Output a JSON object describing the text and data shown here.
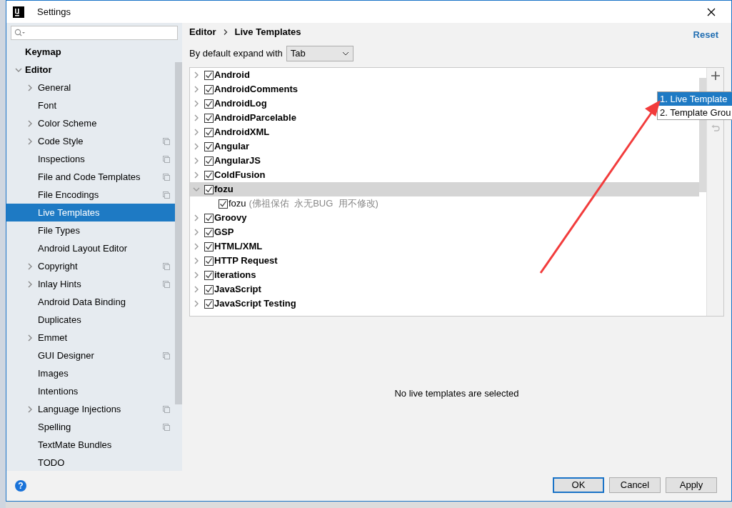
{
  "window": {
    "title": "Settings"
  },
  "sidebar": {
    "items": [
      {
        "label": "Keymap",
        "selected": false
      },
      {
        "label": "Editor",
        "selected": false,
        "expanded": true,
        "children": [
          {
            "label": "General",
            "selected": false,
            "expanded": false,
            "per_project": false
          },
          {
            "label": "Font",
            "selected": false,
            "per_project": false
          },
          {
            "label": "Color Scheme",
            "selected": false,
            "expanded": false,
            "per_project": false
          },
          {
            "label": "Code Style",
            "selected": false,
            "expanded": false,
            "per_project": true
          },
          {
            "label": "Inspections",
            "selected": false,
            "per_project": true
          },
          {
            "label": "File and Code Templates",
            "selected": false,
            "per_project": true
          },
          {
            "label": "File Encodings",
            "selected": false,
            "per_project": true
          },
          {
            "label": "Live Templates",
            "selected": true,
            "per_project": false
          },
          {
            "label": "File Types",
            "selected": false,
            "per_project": false
          },
          {
            "label": "Android Layout Editor",
            "selected": false,
            "per_project": false
          },
          {
            "label": "Copyright",
            "selected": false,
            "expanded": false,
            "per_project": true
          },
          {
            "label": "Inlay Hints",
            "selected": false,
            "expanded": false,
            "per_project": true
          },
          {
            "label": "Android Data Binding",
            "selected": false,
            "per_project": false
          },
          {
            "label": "Duplicates",
            "selected": false,
            "per_project": false
          },
          {
            "label": "Emmet",
            "selected": false,
            "expanded": false,
            "per_project": false
          },
          {
            "label": "GUI Designer",
            "selected": false,
            "per_project": true
          },
          {
            "label": "Images",
            "selected": false,
            "per_project": false
          },
          {
            "label": "Intentions",
            "selected": false,
            "per_project": false
          },
          {
            "label": "Language Injections",
            "selected": false,
            "expanded": false,
            "per_project": true
          },
          {
            "label": "Spelling",
            "selected": false,
            "per_project": true
          },
          {
            "label": "TextMate Bundles",
            "selected": false,
            "per_project": false
          },
          {
            "label": "TODO",
            "selected": false,
            "per_project": false
          }
        ]
      }
    ]
  },
  "breadcrumb": [
    "Editor",
    "Live Templates"
  ],
  "reset_link": "Reset",
  "expand_with": {
    "label": "By default expand with",
    "value": "Tab"
  },
  "templates": [
    {
      "label": "Android",
      "checked": true,
      "expanded": false,
      "selected": false
    },
    {
      "label": "AndroidComments",
      "checked": true,
      "expanded": false,
      "selected": false
    },
    {
      "label": "AndroidLog",
      "checked": true,
      "expanded": false,
      "selected": false
    },
    {
      "label": "AndroidParcelable",
      "checked": true,
      "expanded": false,
      "selected": false
    },
    {
      "label": "AndroidXML",
      "checked": true,
      "expanded": false,
      "selected": false
    },
    {
      "label": "Angular",
      "checked": true,
      "expanded": false,
      "selected": false
    },
    {
      "label": "AngularJS",
      "checked": true,
      "expanded": false,
      "selected": false
    },
    {
      "label": "ColdFusion",
      "checked": true,
      "expanded": false,
      "selected": false
    },
    {
      "label": "fozu",
      "checked": true,
      "expanded": true,
      "selected": true,
      "children": [
        {
          "label": "fozu",
          "description": "(佛祖保佑  永无BUG  用不修改)",
          "checked": true,
          "selected": false
        }
      ]
    },
    {
      "label": "Groovy",
      "checked": true,
      "expanded": false,
      "selected": false
    },
    {
      "label": "GSP",
      "checked": true,
      "expanded": false,
      "selected": false
    },
    {
      "label": "HTML/XML",
      "checked": true,
      "expanded": false,
      "selected": false
    },
    {
      "label": "HTTP Request",
      "checked": true,
      "expanded": false,
      "selected": false
    },
    {
      "label": "iterations",
      "checked": true,
      "expanded": false,
      "selected": false
    },
    {
      "label": "JavaScript",
      "checked": true,
      "expanded": false,
      "selected": false
    },
    {
      "label": "JavaScript Testing",
      "checked": true,
      "expanded": false,
      "selected": false
    }
  ],
  "add_menu": [
    {
      "label": "1. Live Template",
      "selected": true
    },
    {
      "label": "2. Template Grou",
      "selected": false
    }
  ],
  "empty_message": "No live templates are selected",
  "help_button": "?",
  "buttons": [
    {
      "label": "OK",
      "default": true
    },
    {
      "label": "Cancel",
      "default": false
    },
    {
      "label": "Apply",
      "default": false
    }
  ]
}
